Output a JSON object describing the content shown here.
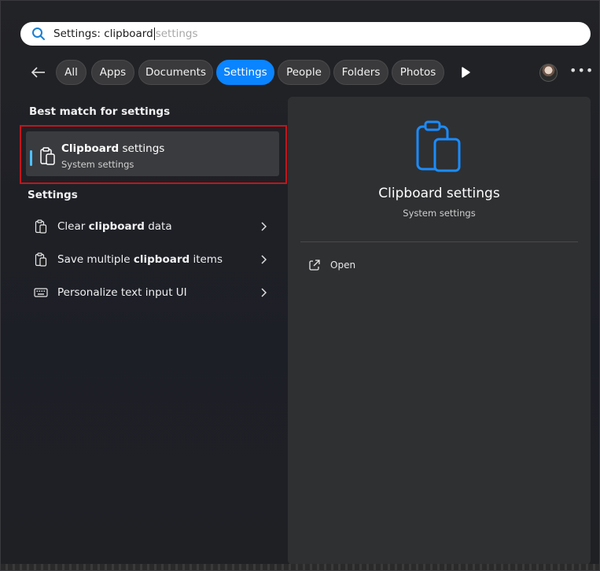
{
  "search": {
    "typed": "Settings: clipboard",
    "suggestion": "settings"
  },
  "filters": [
    {
      "label": "All",
      "active": false
    },
    {
      "label": "Apps",
      "active": false
    },
    {
      "label": "Documents",
      "active": false
    },
    {
      "label": "Settings",
      "active": true
    },
    {
      "label": "People",
      "active": false
    },
    {
      "label": "Folders",
      "active": false
    },
    {
      "label": "Photos",
      "active": false
    }
  ],
  "best_match": {
    "heading": "Best match for settings",
    "title_bold": "Clipboard",
    "title_rest": " settings",
    "subtitle": "System settings",
    "icon": "clipboard-icon"
  },
  "settings_section": {
    "heading": "Settings",
    "items": [
      {
        "pre": "Clear ",
        "bold": "clipboard",
        "post": " data",
        "icon": "clipboard-icon"
      },
      {
        "pre": "Save multiple ",
        "bold": "clipboard",
        "post": " items",
        "icon": "clipboard-icon"
      },
      {
        "pre": "Personalize text input UI",
        "bold": "",
        "post": "",
        "icon": "keyboard-icon"
      }
    ]
  },
  "preview": {
    "title": "Clipboard settings",
    "subtitle": "System settings",
    "actions": [
      {
        "label": "Open",
        "icon": "open-external-icon"
      }
    ]
  },
  "colors": {
    "accent": "#0a84ff",
    "icon_blue": "#1a8cff",
    "highlight_border": "#c2151b"
  }
}
